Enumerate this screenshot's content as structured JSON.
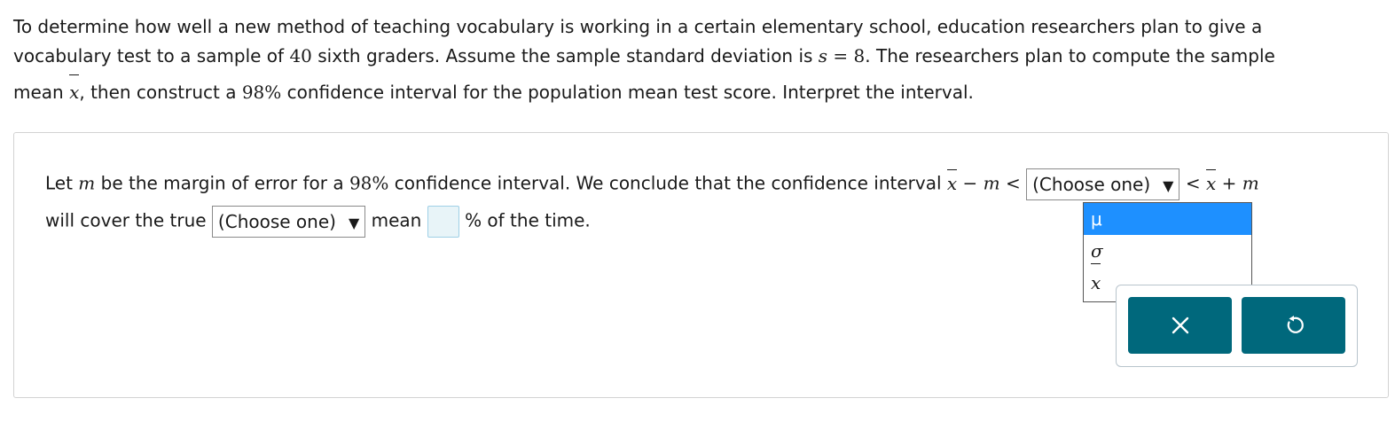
{
  "problem": {
    "line1": "To determine how well a new method of teaching vocabulary is working in a certain elementary school, education researchers plan to give a",
    "line2_a": "vocabulary test to a sample of ",
    "sample_size": "40",
    "line2_b": " sixth graders. Assume the sample standard deviation is ",
    "s_var": "s",
    "eq": " = ",
    "s_value": "8",
    "line2_c": ". The researchers plan to compute the sample",
    "line3_a": "mean ",
    "xbar": "x",
    "line3_b": ", then construct a ",
    "confidence": "98%",
    "line3_c": " confidence interval for the population mean test score. Interpret the interval."
  },
  "answer": {
    "l1_a": "Let ",
    "m": "m",
    "l1_b": " be the margin of error for a ",
    "confidence": "98%",
    "l1_c": " confidence interval. We conclude that the confidence interval ",
    "xbar": "x",
    "minus_m": " − m < ",
    "lt": " < ",
    "plus_m": " + m",
    "l2_a": "will cover the true ",
    "l2_b": " mean ",
    "l2_c": "% of the time.",
    "select1_value": "(Choose one)",
    "select2_value": "(Choose one)",
    "percent_input_value": ""
  },
  "dropdown": {
    "options": [
      "μ",
      "σ",
      "x̄"
    ],
    "selected_index": 0
  },
  "toolbox": {
    "clear_icon": "close-icon",
    "reset_icon": "undo-icon",
    "button_color": "#00687c"
  }
}
